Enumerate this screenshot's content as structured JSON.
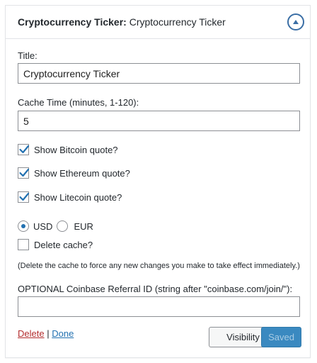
{
  "widget": {
    "title_bold": "Cryptocurrency Ticker:",
    "title_instance": "Cryptocurrency Ticker",
    "toggle_icon": "arrow-up-circle-icon"
  },
  "form": {
    "title_label": "Title:",
    "title_value": "Cryptocurrency Ticker",
    "cache_label": "Cache Time (minutes, 1-120):",
    "cache_value": "5",
    "checkboxes": [
      {
        "label": "Show Bitcoin quote?",
        "checked": true
      },
      {
        "label": "Show Ethereum quote?",
        "checked": true
      },
      {
        "label": "Show Litecoin quote?",
        "checked": true
      }
    ],
    "currency_options": [
      {
        "label": "USD",
        "selected": true
      },
      {
        "label": "EUR",
        "selected": false
      }
    ],
    "delete_cache_label": "Delete cache?",
    "delete_cache_checked": false,
    "delete_cache_note": "(Delete the cache to force any new changes you make to take effect immediately.)",
    "referral_label": "OPTIONAL Coinbase Referral ID (string after \"coinbase.com/join/\"):",
    "referral_value": ""
  },
  "footer": {
    "delete_link": "Delete",
    "separator": "|",
    "done_link": "Done",
    "visibility_button": "Visibility",
    "saved_button": "Saved"
  },
  "colors": {
    "accent": "#2271b1",
    "delete": "#b32d2e",
    "saved_bg": "#3a89c0"
  }
}
